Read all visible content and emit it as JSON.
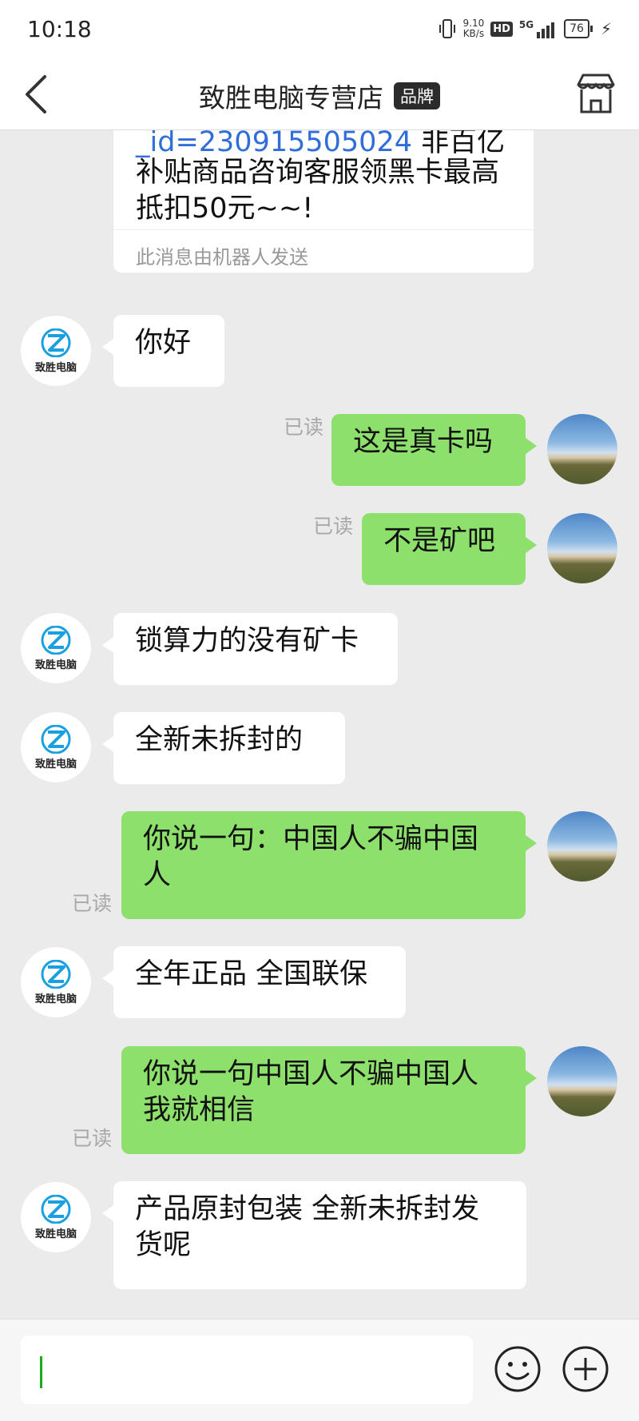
{
  "status_bar": {
    "time": "10:18",
    "speed_value": "9.10",
    "speed_unit": "KB/s",
    "hd": "HD",
    "network": "5G",
    "battery": "76"
  },
  "header": {
    "title": "致胜电脑专营店",
    "badge": "品牌"
  },
  "store_avatar": {
    "label": "致胜电脑"
  },
  "chat": {
    "first_card": {
      "link_fragment": "_id=230915505024",
      "tail_fragment": " 非百亿",
      "body": "补贴商品咨询客服领黑卡最高抵扣50元~~!",
      "note": "此消息由机器人发送"
    },
    "messages": [
      {
        "from": "store",
        "text": "你好"
      },
      {
        "from": "user",
        "text": "这是真卡吗",
        "status": "已读"
      },
      {
        "from": "user",
        "text": "不是矿吧",
        "status": "已读"
      },
      {
        "from": "store",
        "text": "锁算力的没有矿卡"
      },
      {
        "from": "store",
        "text": "全新未拆封的"
      },
      {
        "from": "user",
        "text": "你说一句：中国人不骗中国人",
        "status": "已读"
      },
      {
        "from": "store",
        "text": "全年正品 全国联保"
      },
      {
        "from": "user",
        "text": "你说一句中国人不骗中国人我就相信",
        "status": "已读"
      },
      {
        "from": "store",
        "text": "产品原封包装 全新未拆封发货呢"
      }
    ]
  },
  "input": {
    "value": ""
  },
  "colors": {
    "chat_bg": "#ebebeb",
    "outgoing_bubble": "#8de06c",
    "incoming_bubble": "#ffffff",
    "link": "#2f6ed8",
    "read_label": "#a8a8a8",
    "logo_blue": "#1aa0e0"
  },
  "icons": {
    "back": "chevron-left-icon",
    "shop": "storefront-icon",
    "emoji": "smiley-icon",
    "add": "plus-circle-icon"
  }
}
